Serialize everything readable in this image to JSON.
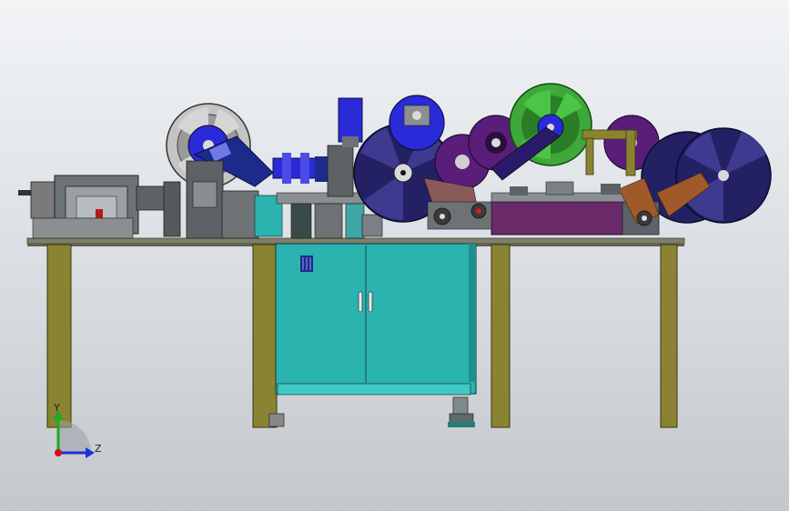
{
  "view": {
    "title": "",
    "axis_triad": {
      "y_label": "Y",
      "z_label": "Z"
    }
  },
  "colors": {
    "background_top": "#f2f4f6",
    "background_bottom": "#c4c8cd",
    "table_legs": "#8a8331",
    "cabinet": "#2bb3b0",
    "reel_dark": "#232064",
    "reel_blue": "#2a2ad8",
    "reel_purple": "#5a1e7a",
    "reel_green": "#3ea838",
    "reel_gray": "#b8b8b8",
    "frame_gray": "#6d7275",
    "plate_purple": "#6a2a6a",
    "axis_y": "#1faa1f",
    "axis_z": "#1f2fd8",
    "axis_origin": "#d01010"
  }
}
